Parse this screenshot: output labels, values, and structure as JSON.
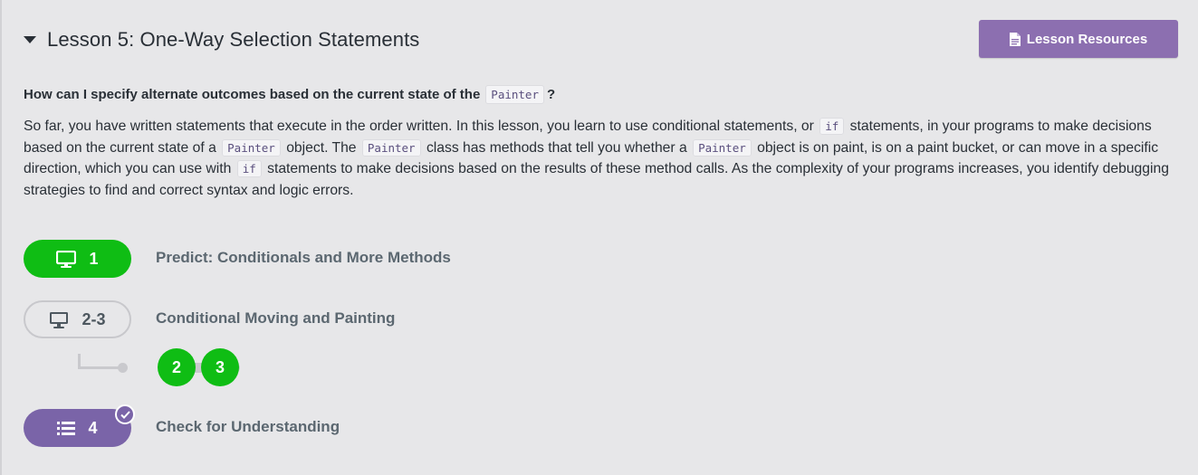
{
  "lesson": {
    "title": "Lesson 5: One-Way Selection Statements",
    "resources_label": "Lesson Resources"
  },
  "question": {
    "text": "How can I specify alternate outcomes based on the current state of the",
    "code": "Painter",
    "end": "?"
  },
  "description": {
    "t1": "So far, you have written statements that execute in the order written. In this lesson, you learn to use conditional statements, or",
    "c1": "if",
    "t2": "statements, in your programs to make decisions based on the current state of a",
    "c2": "Painter",
    "t3": "object. The",
    "c3": "Painter",
    "t4": "class has methods that tell you whether a",
    "c4": "Painter",
    "t5": "object is on paint, is on a paint bucket, or can move in a specific direction, which you can use with",
    "c5": "if",
    "t6": "statements to make decisions based on the results of these method calls. As the complexity of your programs increases, you identify debugging strategies to find and correct syntax and logic errors."
  },
  "levels": [
    {
      "number": "1",
      "label": "Predict: Conditionals and More Methods",
      "icon": "monitor-icon",
      "state": "completed"
    },
    {
      "number": "2-3",
      "label": "Conditional Moving and Painting",
      "icon": "monitor-icon",
      "state": "group",
      "sublevels": [
        "2",
        "3"
      ]
    },
    {
      "number": "4",
      "label": "Check for Understanding",
      "icon": "list-icon",
      "state": "assessment-submitted"
    }
  ],
  "colors": {
    "completed": "#0fbd14",
    "assessment": "#7a64a8",
    "resources_button": "#8c6fb0",
    "background": "#e7e7e9"
  }
}
